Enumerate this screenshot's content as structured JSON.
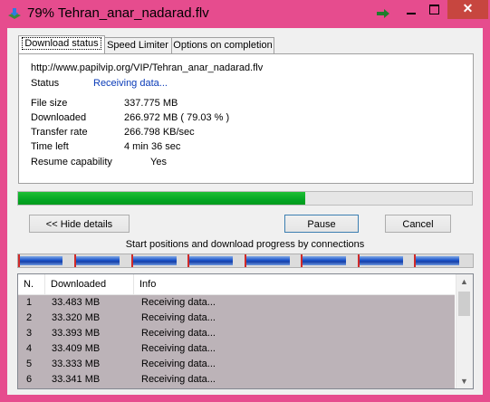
{
  "window": {
    "title": "79% Tehran_anar_nadarad.flv",
    "close_glyph": "✕"
  },
  "tabs": [
    {
      "label": "Download status"
    },
    {
      "label": "Speed Limiter"
    },
    {
      "label": "Options on completion"
    }
  ],
  "status_panel": {
    "url": "http://www.papilvip.org/VIP/Tehran_anar_nadarad.flv",
    "status_label": "Status",
    "status_value": "Receiving data...",
    "fields": [
      {
        "label": "File size",
        "value": "337.775  MB"
      },
      {
        "label": "Downloaded",
        "value": "266.972  MB  ( 79.03 % )"
      },
      {
        "label": "Transfer rate",
        "value": "266.798  KB/sec"
      },
      {
        "label": "Time left",
        "value": "4 min 36 sec"
      },
      {
        "label": "Resume capability",
        "value": "Yes"
      }
    ]
  },
  "progress": {
    "percent": 79.03,
    "color": "#06b02a"
  },
  "buttons": {
    "hide_details": "<< Hide details",
    "pause": "Pause",
    "cancel": "Cancel"
  },
  "connections": {
    "caption": "Start positions and download progress by connections"
  },
  "table": {
    "headers": [
      "N.",
      "Downloaded",
      "Info"
    ],
    "rows": [
      {
        "n": "1",
        "downloaded": "33.483  MB",
        "info": "Receiving data..."
      },
      {
        "n": "2",
        "downloaded": "33.320  MB",
        "info": "Receiving data..."
      },
      {
        "n": "3",
        "downloaded": "33.393  MB",
        "info": "Receiving data..."
      },
      {
        "n": "4",
        "downloaded": "33.409  MB",
        "info": "Receiving data..."
      },
      {
        "n": "5",
        "downloaded": "33.333  MB",
        "info": "Receiving data..."
      },
      {
        "n": "6",
        "downloaded": "33.341  MB",
        "info": "Receiving data..."
      }
    ]
  },
  "icons": {
    "app": "download-arrow-icon",
    "tray": "tray-arrow-icon",
    "scroll_up": "scroll-up-icon",
    "scroll_down": "scroll-down-icon"
  },
  "colors": {
    "title_bar": "#e64c8e",
    "close_button": "#c7463f",
    "progress_green": "#06b02a",
    "connection_blue": "#1a52c8",
    "status_blue": "#0a3bb8",
    "row_selected": "#bcb3b8"
  }
}
